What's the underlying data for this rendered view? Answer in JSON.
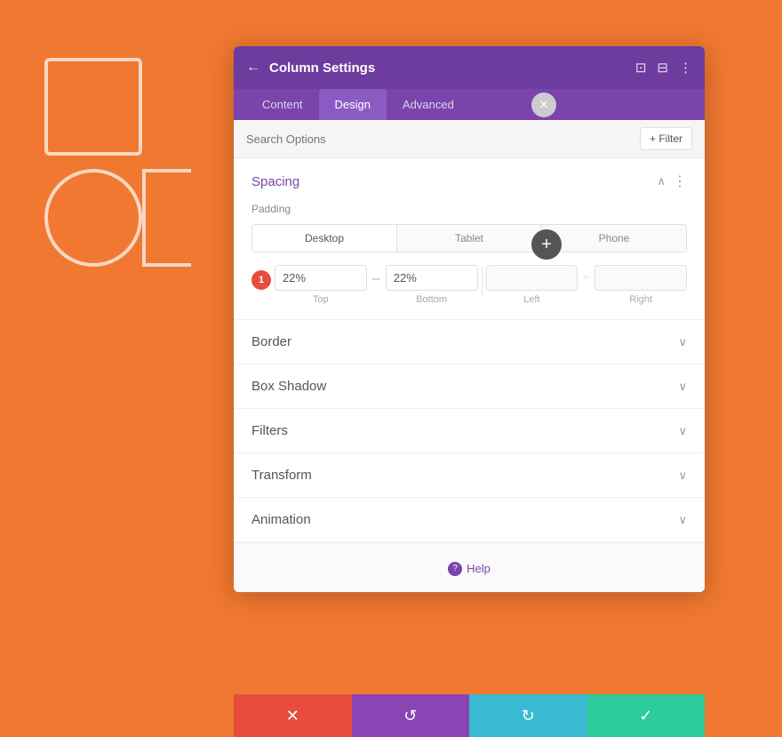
{
  "background": {
    "color": "#f07830"
  },
  "floatingClose": {
    "icon": "✕"
  },
  "floatingAdd": {
    "icon": "+"
  },
  "panel": {
    "title": "Column Settings",
    "backIcon": "←",
    "headerIcons": [
      "⊡",
      "⊟",
      "⋮"
    ],
    "tabs": [
      {
        "label": "Content",
        "active": false
      },
      {
        "label": "Design",
        "active": true
      },
      {
        "label": "Advanced",
        "active": false
      }
    ],
    "search": {
      "placeholder": "Search Options",
      "filterLabel": "+ Filter"
    },
    "sections": {
      "spacing": {
        "title": "Spacing",
        "padding": {
          "label": "Padding",
          "deviceTabs": [
            "Desktop",
            "Tablet",
            "Phone"
          ],
          "activeDevice": "Desktop",
          "stepBadge": "1",
          "topValue": "22%",
          "bottomValue": "22%",
          "leftValue": "",
          "rightValue": "",
          "labels": [
            "Top",
            "Bottom",
            "Left",
            "Right"
          ]
        }
      },
      "border": {
        "title": "Border"
      },
      "boxShadow": {
        "title": "Box Shadow"
      },
      "filters": {
        "title": "Filters"
      },
      "transform": {
        "title": "Transform"
      },
      "animation": {
        "title": "Animation"
      }
    },
    "footer": {
      "helpIcon": "?",
      "helpLabel": "Help"
    },
    "actions": {
      "cancel": "✕",
      "undo": "↺",
      "redo": "↻",
      "save": "✓"
    }
  }
}
